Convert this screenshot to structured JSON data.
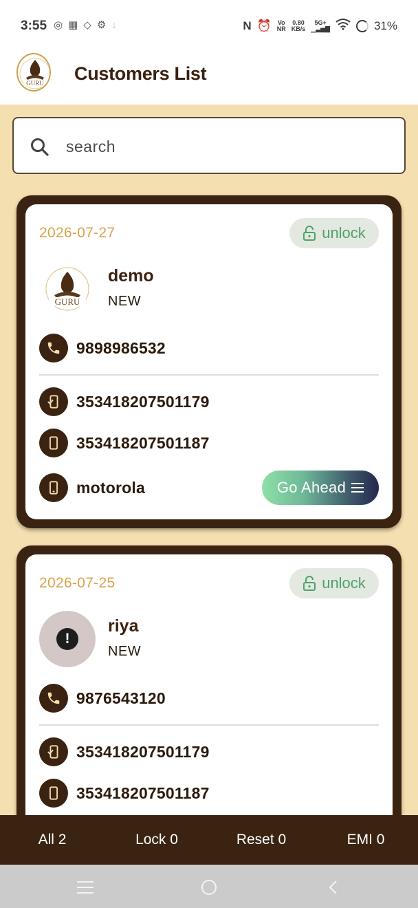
{
  "status_bar": {
    "time": "3:55",
    "net_speed_value": "0.80",
    "net_speed_unit": "KB/s",
    "vo": "Vo",
    "nr": "NR",
    "signal_label": "5G+",
    "battery": "31%"
  },
  "app_bar": {
    "title": "Customers List"
  },
  "search": {
    "placeholder": "search"
  },
  "customers": [
    {
      "date": "2026-07-27",
      "unlock_label": "unlock",
      "name": "demo",
      "status": "NEW",
      "phone": "9898986532",
      "imei1": "353418207501179",
      "imei2": "353418207501187",
      "brand": "motorola",
      "action_label": "Go Ahead"
    },
    {
      "date": "2026-07-25",
      "unlock_label": "unlock",
      "name": "riya",
      "status": "NEW",
      "phone": "9876543120",
      "imei1": "353418207501179",
      "imei2": "353418207501187"
    }
  ],
  "bottom_tabs": [
    {
      "label": "All 2"
    },
    {
      "label": "Lock 0"
    },
    {
      "label": "Reset 0"
    },
    {
      "label": "EMI 0"
    }
  ],
  "colors": {
    "background": "#f4dfb0",
    "brand_brown": "#3b2312",
    "date_accent": "#d9a24a",
    "unlock_green": "#4ca36a"
  }
}
